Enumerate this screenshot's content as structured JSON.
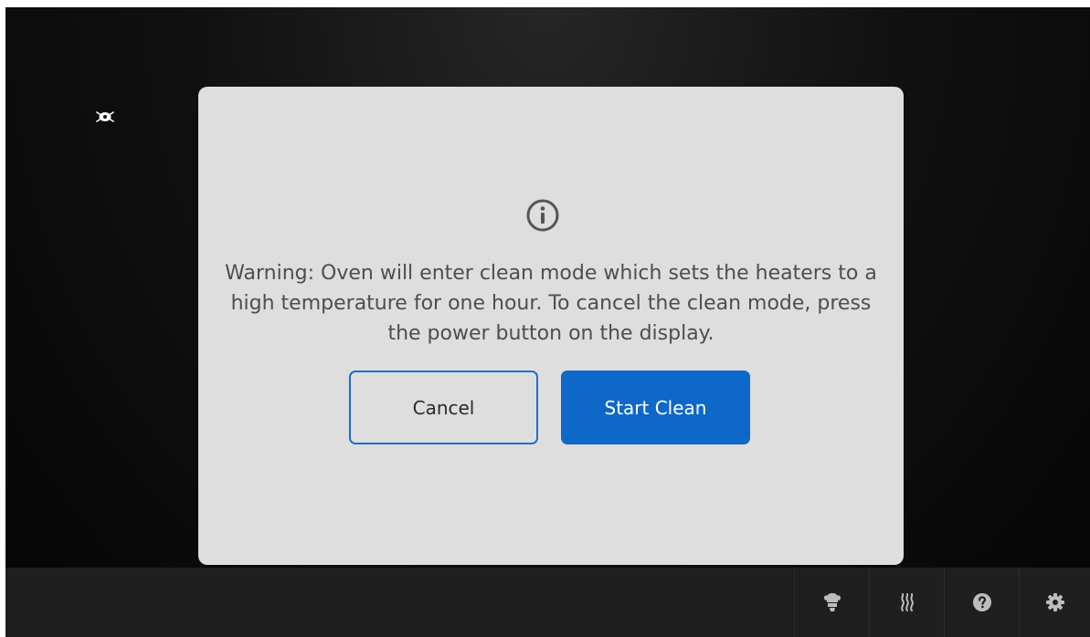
{
  "dialog": {
    "message": "Warning: Oven will enter clean mode which sets the heaters to a high temperature for one hour. To cancel the clean mode, press the power button on the display.",
    "cancel_label": "Cancel",
    "start_label": "Start Clean",
    "info_icon": "info-circle-icon"
  },
  "status": {
    "icon": "remote-connection-icon"
  },
  "bottom_bar": {
    "items": [
      {
        "icon": "chef-icon"
      },
      {
        "icon": "steam-icon"
      },
      {
        "icon": "help-icon"
      },
      {
        "icon": "gear-icon"
      }
    ]
  },
  "colors": {
    "accent": "#0d68c9",
    "dialog_bg": "#dedede",
    "screen_bg": "#111111",
    "bar_bg": "#1f1f1f",
    "text": "#4e4e4e"
  }
}
